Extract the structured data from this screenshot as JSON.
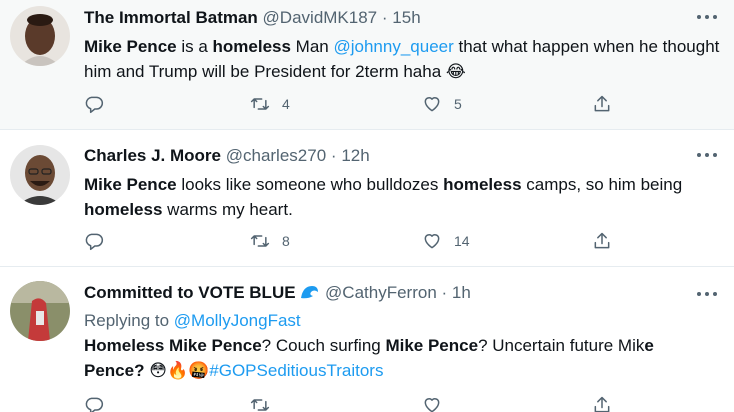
{
  "tweets": [
    {
      "name": "The Immortal Batman",
      "handle": "@DavidMK187",
      "separator": "·",
      "time": "15h",
      "body": {
        "p1": "Mike Pence",
        "p2": " is a ",
        "p3": "homeless",
        "p4": " Man ",
        "p5": "@johnny_queer",
        "p6": " that what happen when he thought him and Trump will be President for 2term haha ",
        "emoji": "😂"
      },
      "reply_count": "",
      "retweet_count": "4",
      "like_count": "5"
    },
    {
      "name": "Charles J. Moore",
      "handle": "@charles270",
      "separator": "·",
      "time": "12h",
      "body": {
        "p1": "Mike Pence",
        "p2": " looks like someone who bulldozes ",
        "p3": "homeless",
        "p4": " camps, so him being ",
        "p5": "homeless",
        "p6": " warms my heart."
      },
      "reply_count": "",
      "retweet_count": "8",
      "like_count": "14"
    },
    {
      "name": "Committed to VOTE BLUE",
      "name_icon": "wave-icon",
      "handle": "@CathyFerron",
      "separator": "·",
      "time": "1h",
      "replying_prefix": "Replying to ",
      "replying_handle": "@MollyJongFast",
      "body": {
        "p1": "Homeless Mike Pence",
        "p2": "? Couch surfing ",
        "p3": "Mike Pence",
        "p4": "? Uncertain future Mik",
        "p5": "e",
        "p6": "Pence?",
        "emojis": "😳🔥🤬",
        "hashtag": "#GOPSeditiousTraitors"
      },
      "reply_count": "",
      "retweet_count": "",
      "like_count": ""
    }
  ],
  "colors": {
    "link": "#1d9bf0",
    "secondary": "#536471",
    "highlight_bg": "#f7f9f9",
    "divider": "#e6ecf0"
  },
  "icons": [
    "reply-icon",
    "retweet-icon",
    "like-icon",
    "share-icon",
    "more-icon",
    "wave-icon"
  ]
}
